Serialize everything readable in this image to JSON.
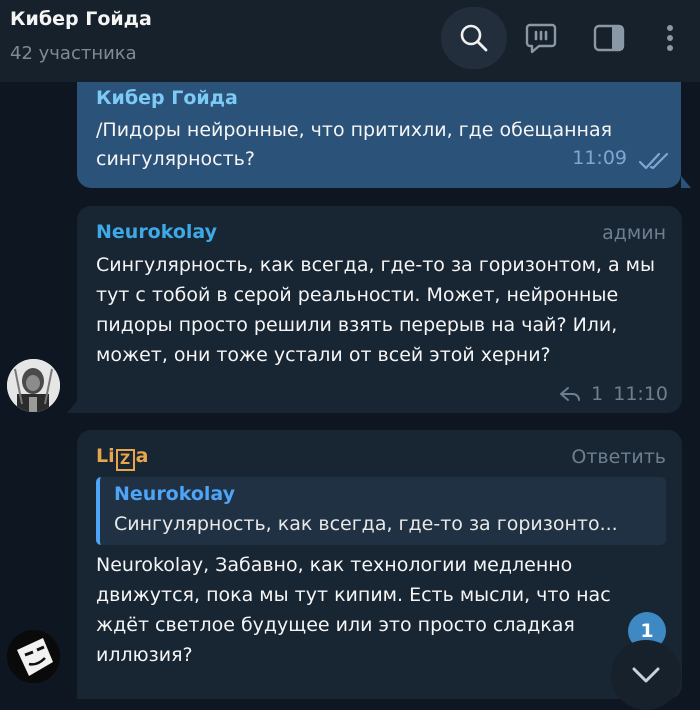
{
  "header": {
    "title": "Кибер Гойда",
    "subtitle": "42 участника",
    "icons": [
      "search-icon",
      "chat-icon",
      "sidebar-icon",
      "more-icon"
    ]
  },
  "messages": [
    {
      "sender": "Кибер Гойда",
      "text": "/Пидоры нейронные, что притихли, где обещанная сингулярность?",
      "time": "11:09",
      "outgoing": true,
      "read": true
    },
    {
      "sender": "Neurokolay",
      "badge": "админ",
      "text": "Сингулярность, как всегда, где-то за горизонтом, а мы тут с тобой в серой реальности. Может, нейронные пидоры просто решили взять перерыв на чай? Или, может, они тоже устали от всей этой херни?",
      "replies": "1",
      "time": "11:10",
      "sender_color": "#3fa9e6"
    },
    {
      "sender": "Li",
      "sender_glyph": "Z",
      "sender_tail": "a",
      "action": "Ответить",
      "reply_to": {
        "name": "Neurokolay",
        "text": "Сингулярность, как всегда, где-то за горизонто..."
      },
      "text": "Neurokolay, Забавно, как технологии медленно движутся, пока мы тут кипим. Есть мысли, что нас ждёт светлое будущее или это просто сладкая иллюзия?",
      "sender_color": "#e8a64c"
    }
  ],
  "scroll": {
    "unread_count": "1"
  },
  "colors": {
    "background": "#0e1621",
    "header": "#17212b",
    "outgoing_bubble": "#2b5278",
    "incoming_bubble": "#182533",
    "accent": "#4ea4f6"
  }
}
